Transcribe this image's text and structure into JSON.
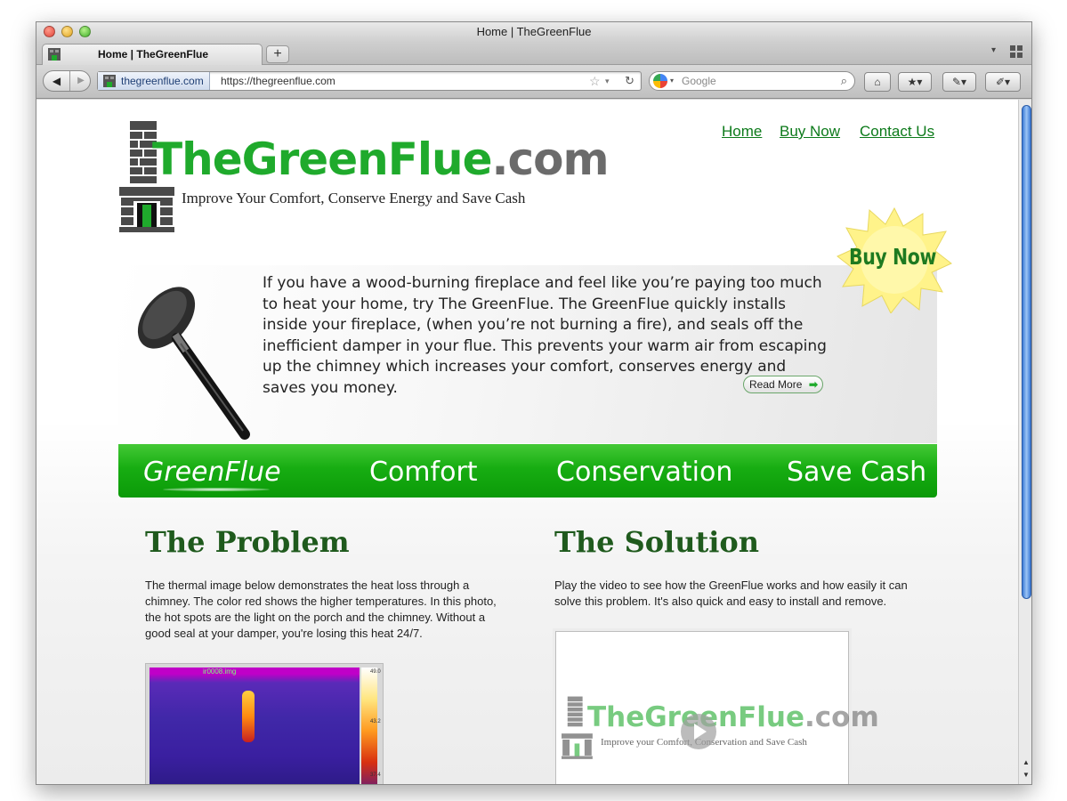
{
  "window": {
    "title": "Home | TheGreenFlue"
  },
  "tabs": [
    {
      "label": "Home | TheGreenFlue",
      "close": "×"
    }
  ],
  "new_tab_label": "+",
  "navbar": {
    "back": "◀",
    "forward": "▶",
    "identity": "thegreenflue.com",
    "url": "https://thegreenflue.com",
    "star": "☆",
    "dropdown": "▾",
    "reload": "↻",
    "search_placeholder": "Google",
    "search_engine_drop": "▾",
    "search_icon": "⌕",
    "home": "⌂",
    "bookmarks": "★▾",
    "addons": "✎▾",
    "tools": "✐▾"
  },
  "site": {
    "nav": [
      "Home",
      "Buy Now",
      "Contact Us"
    ],
    "logo_main": "TheGreenFlue",
    "logo_suffix": ".com",
    "tagline": "Improve Your Comfort, Conserve Energy and Save Cash",
    "badge_label": "Buy Now",
    "hero_text": "If you have a wood-burning fireplace and feel like you’re paying too much to heat your home, try The GreenFlue. The GreenFlue quickly installs inside your fireplace, (when you’re not burning a fire), and seals off the inefficient damper in your flue. This prevents your warm air from escaping up the chimney which increases your comfort, conserves energy and saves you money.",
    "read_more": "Read More",
    "read_more_arrow": "➡",
    "greenbar": [
      "GreenFlue",
      "Comfort",
      "Conservation",
      "Save Cash"
    ],
    "problem": {
      "heading": "The Problem",
      "body": "The thermal image below demonstrates the heat loss through a chimney. The color red shows the higher temperatures. In this photo, the hot spots are the light on the porch and the chimney. Without a good seal at your damper, you're losing this heat 24/7.",
      "image_label": "ir0008.img",
      "scale": [
        "49.0",
        "43.2",
        "37.4"
      ]
    },
    "solution": {
      "heading": "The Solution",
      "body": "Play the video to see how the GreenFlue works and how easily it can solve this problem. It's also quick and easy to install and remove.",
      "video_logo_main": "TheGreenFlue",
      "video_logo_suffix": ".com",
      "video_tagline": "Improve your Comfort, Conservation and Save Cash"
    }
  },
  "colors": {
    "brand_green": "#1faa2c",
    "heading_green": "#1f5a1d",
    "link_green": "#0c7a1a",
    "bar_green": "#17ad12"
  }
}
